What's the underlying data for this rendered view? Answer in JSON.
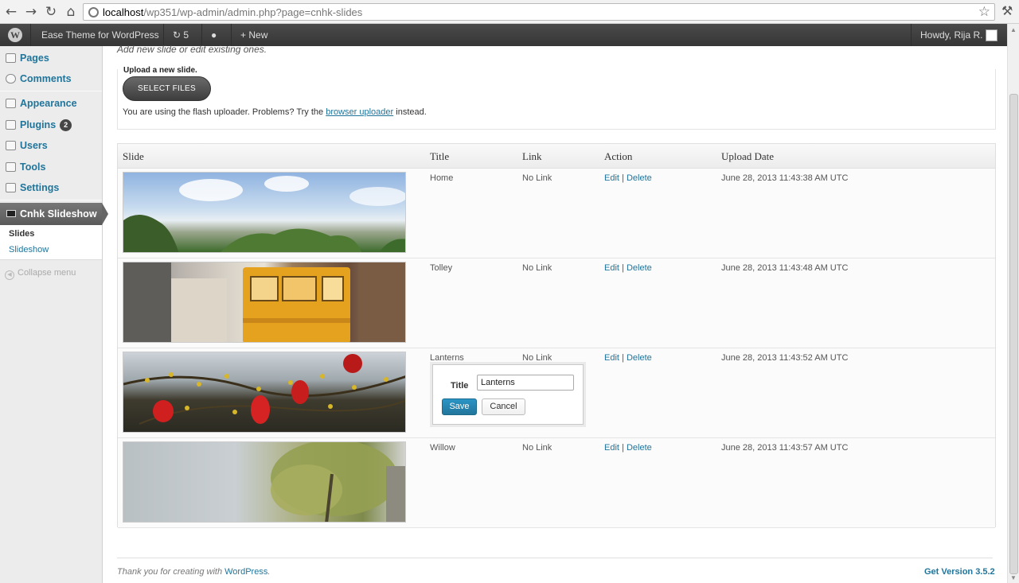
{
  "browser": {
    "url_host": "localhost",
    "url_path": "/wp351/wp-admin/admin.php?page=cnhk-slides",
    "icons": {
      "back": "back-arrow-icon",
      "forward": "forward-arrow-icon",
      "reload": "reload-icon",
      "home": "home-icon",
      "bookmark": "star-icon",
      "settings": "wrench-icon"
    }
  },
  "adminbar": {
    "site_name": "Ease Theme for WordPress",
    "updates_count": "5",
    "new_label": "New",
    "greeting": "Howdy, Rija R."
  },
  "sidebar": {
    "items": [
      {
        "label": "Pages",
        "icon": "pages-icon"
      },
      {
        "label": "Comments",
        "icon": "comments-icon"
      },
      {
        "label": "Appearance",
        "icon": "appearance-icon"
      },
      {
        "label": "Plugins",
        "icon": "plugins-icon",
        "badge": "2"
      },
      {
        "label": "Users",
        "icon": "users-icon"
      },
      {
        "label": "Tools",
        "icon": "tools-icon"
      },
      {
        "label": "Settings",
        "icon": "settings-icon"
      }
    ],
    "active": {
      "label": "Cnhk Slideshow",
      "icon": "slideshow-icon"
    },
    "submenu": [
      {
        "label": "Slides",
        "current": true
      },
      {
        "label": "Slideshow",
        "current": false
      }
    ],
    "collapse_label": "Collapse menu"
  },
  "content": {
    "intro": "Add new slide or edit existing ones.",
    "upload_title": "Upload a new slide.",
    "select_files": "SELECT FILES",
    "flash_note_before": "You are using the flash uploader. Problems? Try the ",
    "flash_note_link": "browser uploader",
    "flash_note_after": " instead."
  },
  "table": {
    "headers": [
      "Slide",
      "Title",
      "Link",
      "Action",
      "Upload Date"
    ],
    "rows": [
      {
        "title": "Home",
        "link": "No Link",
        "edit": "Edit",
        "delete": "Delete",
        "sep": "|",
        "date": "June 28, 2013 11:43:38 AM UTC"
      },
      {
        "title": "Tolley",
        "link": "No Link",
        "edit": "Edit",
        "delete": "Delete",
        "sep": "|",
        "date": "June 28, 2013 11:43:48 AM UTC"
      },
      {
        "title": "Lanterns",
        "link": "No Link",
        "edit": "Edit",
        "delete": "Delete",
        "sep": "|",
        "date": "June 28, 2013 11:43:52 AM UTC"
      },
      {
        "title": "Willow",
        "link": "No Link",
        "edit": "Edit",
        "delete": "Delete",
        "sep": "|",
        "date": "June 28, 2013 11:43:57 AM UTC"
      }
    ]
  },
  "edit_popup": {
    "label": "Title",
    "value": "Lanterns",
    "save": "Save",
    "cancel": "Cancel"
  },
  "footer": {
    "thanks_before": "Thank you for creating with ",
    "thanks_link": "WordPress",
    "thanks_after": ".",
    "version": "Get Version 3.5.2"
  },
  "colors": {
    "link": "#21759b",
    "adminbar": "#464646",
    "save_button": "#21759b"
  }
}
